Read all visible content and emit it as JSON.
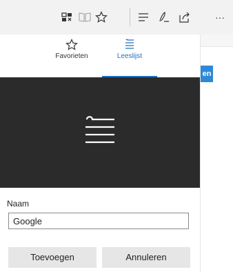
{
  "toolbar": {
    "icons": [
      "add-notes-icon",
      "reading-view-icon",
      "favorite-star-icon",
      "hub-icon",
      "web-note-icon",
      "share-icon",
      "more-icon"
    ],
    "more_label": "···"
  },
  "panel": {
    "tabs": [
      {
        "label": "Favorieten",
        "icon": "star-icon",
        "active": false
      },
      {
        "label": "Leeslijst",
        "icon": "reading-list-icon",
        "active": true
      }
    ],
    "name_label": "Naam",
    "name_value": "Google",
    "add_button": "Toevoegen",
    "cancel_button": "Annuleren"
  },
  "background": {
    "button_fragment": "en",
    "accent": "#2f88d6"
  },
  "colors": {
    "active_tab": "#1f6ec2",
    "preview_bg": "#2b2b2b",
    "toolbar_bg": "#f2f2f2"
  }
}
